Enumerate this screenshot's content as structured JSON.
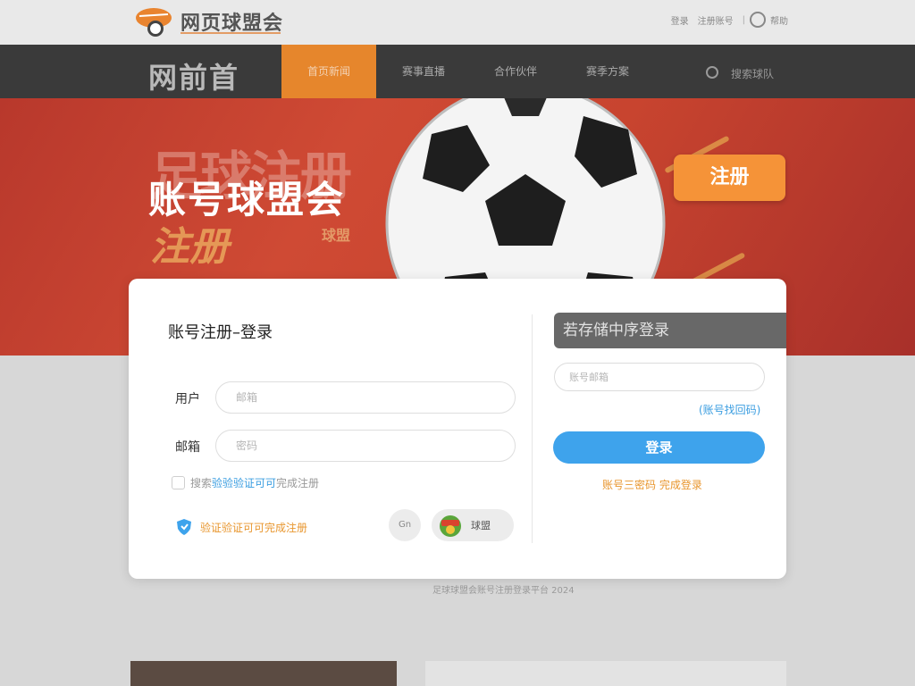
{
  "header": {
    "logo_icon": "football-club-logo",
    "site_name": "网页球盟会",
    "top_links": [
      "登录",
      "注册账号"
    ],
    "top_right": "帮助"
  },
  "nav": {
    "brand": "网前首",
    "items": [
      {
        "label": "首页新闻",
        "active": true
      },
      {
        "label": "赛事直播",
        "active": false
      },
      {
        "label": "合作伙伴",
        "active": false
      },
      {
        "label": "赛季方案",
        "active": false
      }
    ],
    "search_label": "搜索球队"
  },
  "hero": {
    "title": "账号球盟会",
    "bg_text_1": "足球注册",
    "bg_text_2": "注册",
    "bg_text_3": "球盟",
    "register_label": "注册"
  },
  "card": {
    "title": "账号注册–登录",
    "user_label": "用户",
    "user_placeholder": "邮箱",
    "email_label": "邮箱",
    "email_placeholder": "密码",
    "agree_prefix": "搜索",
    "agree_highlight": "验验验证可可",
    "agree_suffix": "完成注册",
    "verify_text": "验证验证可可完成注册",
    "circle_btn_label": "Gn",
    "club_label": "球盟",
    "right_header": "若存储中序登录",
    "right_placeholder": "账号邮箱",
    "forgot_link": "(账号找回码)",
    "login_label": "登录",
    "right_bottom": "账号三密码 完成登录"
  },
  "footer_note": "足球球盟会账号注册登录平台 2024",
  "colors": {
    "accent_orange": "#f59338",
    "nav_active": "#e6862c",
    "login_blue": "#3ea3ec",
    "hero_red": "#c8442f"
  }
}
